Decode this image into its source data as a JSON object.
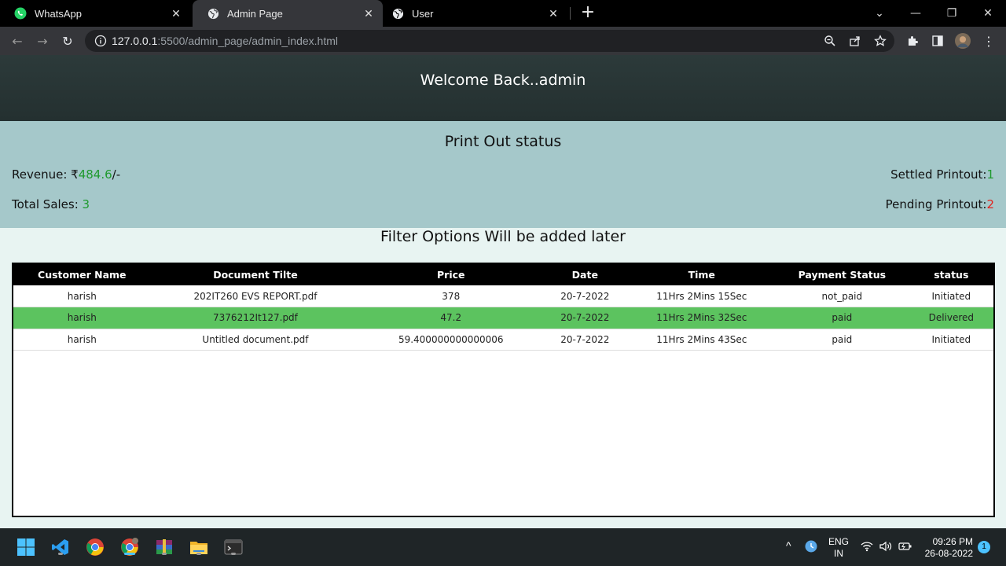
{
  "browser": {
    "tabs": [
      {
        "label": "WhatsApp",
        "active": false
      },
      {
        "label": "Admin Page",
        "active": true
      },
      {
        "label": "User",
        "active": false
      }
    ],
    "url_host": "127.0.0.1",
    "url_path": ":5500/admin_page/admin_index.html"
  },
  "page": {
    "welcome": "Welcome Back..admin",
    "status_title": "Print Out status",
    "revenue_label": "Revenue: ",
    "revenue_currency": "₹",
    "revenue_value": "484.6",
    "revenue_suffix": "/-",
    "total_sales_label": "Total Sales: ",
    "total_sales_value": "3",
    "settled_label": "Settled Printout:",
    "settled_value": "1",
    "pending_label": "Pending Printout:",
    "pending_value": "2",
    "filter_text": "Filter Options Will be added later"
  },
  "table": {
    "headers": [
      "Customer Name",
      "Document Tilte",
      "Price",
      "Date",
      "Time",
      "Payment Status",
      "status"
    ],
    "rows": [
      {
        "cells": [
          "harish",
          "202IT260 EVS REPORT.pdf",
          "378",
          "20-7-2022",
          "11Hrs 2Mins 15Sec",
          "not_paid",
          "Initiated"
        ],
        "delivered": false
      },
      {
        "cells": [
          "harish",
          "7376212It127.pdf",
          "47.2",
          "20-7-2022",
          "11Hrs 2Mins 32Sec",
          "paid",
          "Delivered"
        ],
        "delivered": true
      },
      {
        "cells": [
          "harish",
          "Untitled document.pdf",
          "59.400000000000006",
          "20-7-2022",
          "11Hrs 2Mins 43Sec",
          "paid",
          "Initiated"
        ],
        "delivered": false
      }
    ]
  },
  "taskbar": {
    "lang_top": "ENG",
    "lang_bottom": "IN",
    "time": "09:26 PM",
    "date": "26-08-2022",
    "notification_count": "1"
  },
  "colors": {
    "delivered_row": "#5cc35f",
    "positive": "#1f9a2e",
    "negative": "#e3211c"
  }
}
